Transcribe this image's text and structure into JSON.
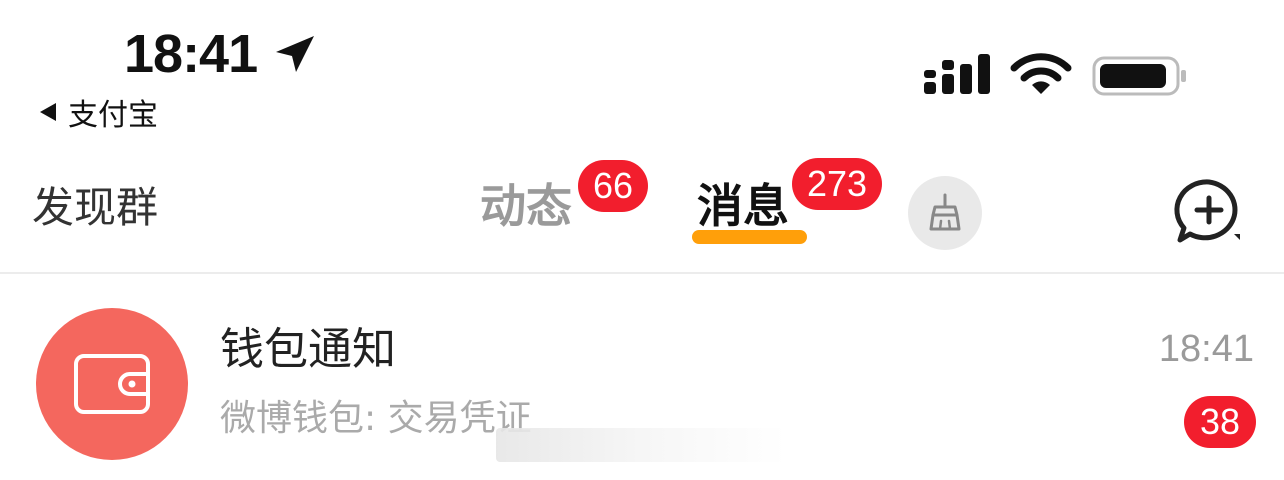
{
  "status_bar": {
    "time": "18:41",
    "back_app": "支付宝",
    "icons": [
      "location-arrow-icon",
      "cellular-signal-icon",
      "wifi-icon",
      "battery-icon"
    ]
  },
  "header": {
    "left_tab": "发现群",
    "tabs": [
      {
        "label": "动态",
        "badge": "66",
        "active": false
      },
      {
        "label": "消息",
        "badge": "273",
        "active": true
      }
    ],
    "icons": [
      "broom-icon",
      "add-chat-icon"
    ]
  },
  "messages": [
    {
      "title": "钱包通知",
      "subtitle": "微博钱包: 交易凭证",
      "time": "18:41",
      "unread": "38",
      "avatar_icon": "wallet-icon"
    }
  ],
  "colors": {
    "badge": "#f21e2d",
    "tab_underline": "#ff9f0a",
    "avatar_bg": "#f4675e",
    "inactive_tab": "#9a9a9a"
  }
}
